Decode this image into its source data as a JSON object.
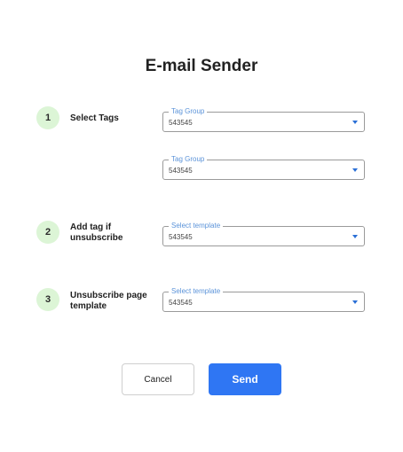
{
  "title": "E-mail Sender",
  "steps": [
    {
      "number": "1",
      "label": "Select Tags",
      "fields": [
        {
          "legend": "Tag Group",
          "value": "543545"
        },
        {
          "legend": "Tag Group",
          "value": "543545"
        }
      ]
    },
    {
      "number": "2",
      "label": "Add tag if unsubscribe",
      "fields": [
        {
          "legend": "Select template",
          "value": "543545"
        }
      ]
    },
    {
      "number": "3",
      "label": "Unsubscribe page template",
      "fields": [
        {
          "legend": "Select template",
          "value": "543545"
        }
      ]
    }
  ],
  "actions": {
    "cancel_label": "Cancel",
    "send_label": "Send"
  },
  "colors": {
    "accent": "#2f76f3",
    "step_badge": "#dcf5d6",
    "legend_text": "#5b93d9"
  }
}
